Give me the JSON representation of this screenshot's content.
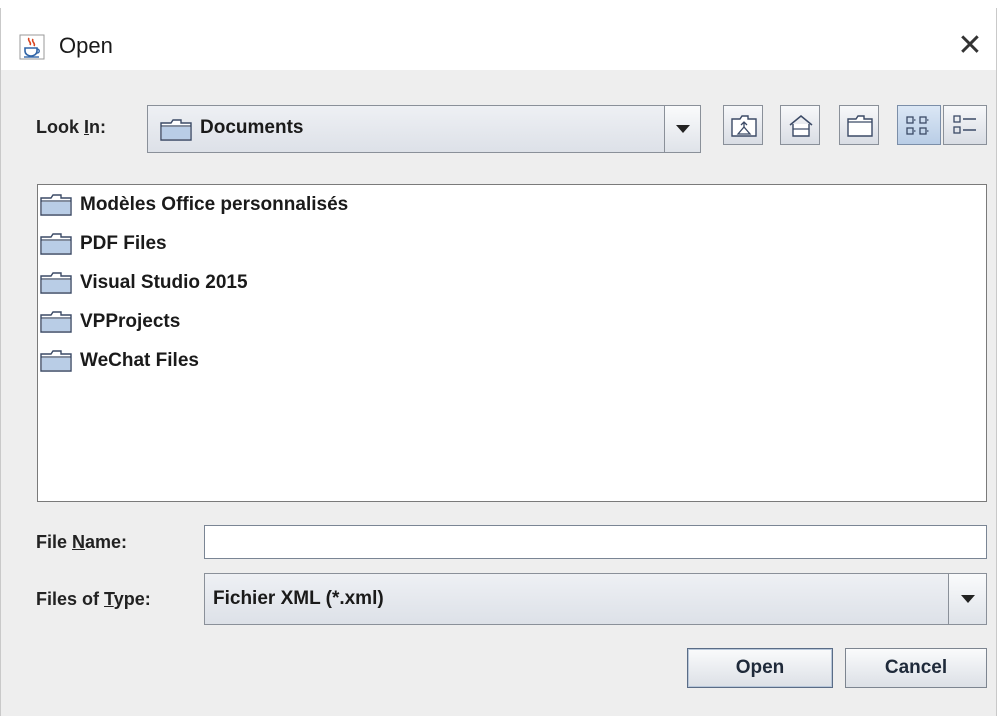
{
  "window": {
    "title": "Open",
    "app_icon": "java-coffee-cup-icon",
    "close_label": "✕"
  },
  "look_in": {
    "label_prefix": "Look ",
    "label_mnemonic": "I",
    "label_suffix": "n:",
    "value": "Documents",
    "value_icon": "folder-icon"
  },
  "toolbar": {
    "up_one_level": "up-folder-icon",
    "home": "home-icon",
    "new_folder": "new-folder-icon",
    "list_view": "list-view-icon",
    "details_view": "details-view-icon",
    "selected_view": "list"
  },
  "files": [
    {
      "name": "Modèles Office personnalisés",
      "icon": "folder-icon"
    },
    {
      "name": "PDF Files",
      "icon": "folder-icon"
    },
    {
      "name": "Visual Studio 2015",
      "icon": "folder-icon"
    },
    {
      "name": "VPProjects",
      "icon": "folder-icon"
    },
    {
      "name": "WeChat Files",
      "icon": "folder-icon"
    }
  ],
  "file_name": {
    "label_prefix": "File ",
    "label_mnemonic": "N",
    "label_suffix": "ame:",
    "value": ""
  },
  "file_type": {
    "label_prefix": "Files of ",
    "label_mnemonic": "T",
    "label_suffix": "ype:",
    "value": "Fichier XML (*.xml)"
  },
  "buttons": {
    "open": "Open",
    "cancel": "Cancel"
  },
  "colors": {
    "dialog_bg": "#eeeeee",
    "selected_toggle": "#b9cde6"
  }
}
